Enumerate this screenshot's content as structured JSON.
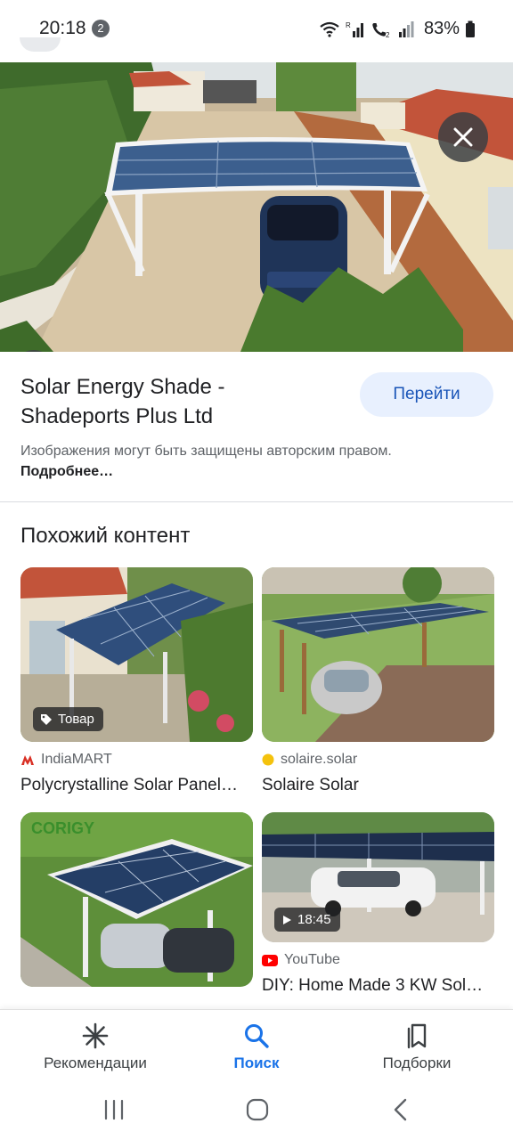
{
  "status": {
    "time": "20:18",
    "notif_count": "2",
    "battery": "83%"
  },
  "detail": {
    "title": "Solar Energy Shade - Shadeports Plus Ltd",
    "goto_label": "Перейти",
    "copyright_text": "Изображения могут быть защищены авторским правом.",
    "copyright_link": "Подробнее…"
  },
  "similar": {
    "heading": "Похожий контент",
    "items": [
      {
        "source": "IndiaMART",
        "title": "Polycrystalline Solar Panel…",
        "badge": "Товар",
        "source_icon": "indiamart-logo-icon"
      },
      {
        "source": "solaire.solar",
        "title": "Solaire Solar",
        "badge": "",
        "source_icon": "solaire-dot-icon"
      },
      {
        "source": "",
        "title": "",
        "badge": "",
        "overlay_text": "CORIGY"
      },
      {
        "source": "YouTube",
        "title": "DIY: Home Made 3 KW Sol…",
        "badge": "18:45",
        "source_icon": "youtube-icon"
      }
    ]
  },
  "bottom_nav": {
    "items": [
      {
        "label": "Рекомендации",
        "icon": "asterisk-icon"
      },
      {
        "label": "Поиск",
        "icon": "search-icon",
        "active": true
      },
      {
        "label": "Подборки",
        "icon": "bookmarks-icon"
      }
    ]
  },
  "colors": {
    "accent": "#1a73e8",
    "goto_bg": "#e8f0fe",
    "muted_text": "#5f6368"
  }
}
